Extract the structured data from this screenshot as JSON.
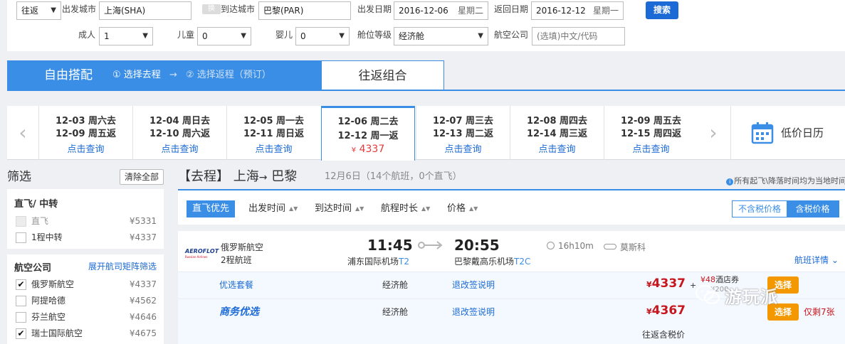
{
  "search": {
    "trip_type": "往返",
    "from_label": "出发城市",
    "from_value": "上海(SHA)",
    "swap_label": "换",
    "to_label": "到达城市",
    "to_value": "巴黎(PAR)",
    "depart_label": "出发日期",
    "depart_value": "2016-12-06",
    "depart_week": "星期二",
    "return_label": "返回日期",
    "return_value": "2016-12-12",
    "return_week": "星期一",
    "search_button": "搜索",
    "adult_label": "成人",
    "adult_value": "1",
    "child_label": "儿童",
    "child_value": "0",
    "infant_label": "婴儿",
    "infant_value": "0",
    "cabin_label": "舱位等级",
    "cabin_value": "经济舱",
    "airline_label": "航空公司",
    "airline_placeholder": "(选填)中文/代码"
  },
  "mode": {
    "free_title": "自由搭配",
    "step1": "① 选择去程",
    "step_arrow": "→",
    "step2": "② 选择返程（预订）",
    "round_title": "往返组合"
  },
  "dates": {
    "cells": [
      {
        "out": "12-03 周六去",
        "ret": "12-09 周五返",
        "action": "点击查询"
      },
      {
        "out": "12-04 周日去",
        "ret": "12-10 周六返",
        "action": "点击查询"
      },
      {
        "out": "12-05 周一去",
        "ret": "12-11 周日返",
        "action": "点击查询"
      },
      {
        "out": "12-06 周二去",
        "ret": "12-12 周一返",
        "currency": "¥",
        "price": "4337"
      },
      {
        "out": "12-07 周三去",
        "ret": "12-13 周二返",
        "action": "点击查询"
      },
      {
        "out": "12-08 周四去",
        "ret": "12-14 周三返",
        "action": "点击查询"
      },
      {
        "out": "12-09 周五去",
        "ret": "12-15 周四返",
        "action": "点击查询"
      }
    ],
    "calendar_label": "低价日历"
  },
  "filter": {
    "title": "筛选",
    "clear_button": "清除全部",
    "direct_title": "直飞/ 中转",
    "direct_items": [
      {
        "name": "直飞",
        "price": "¥5331"
      },
      {
        "name": "1程中转",
        "price": "¥4337"
      }
    ],
    "airline_title": "航空公司",
    "matrix_link": "展开航司矩阵筛选",
    "airlines": [
      {
        "name": "俄罗斯航空",
        "price": "¥4337",
        "check": "✔"
      },
      {
        "name": "阿提哈德",
        "price": "¥4562",
        "check": ""
      },
      {
        "name": "芬兰航空",
        "price": "¥4646",
        "check": ""
      },
      {
        "name": "瑞士国际航空",
        "price": "¥4675",
        "check": "✔"
      }
    ]
  },
  "route": {
    "title_prefix": "【去程】 上海",
    "title_arrow": "→",
    "title_suffix": " 巴黎",
    "meta": "12月6日（14个航班，0个直飞）",
    "note_icon": "i",
    "note": "所有起飞\\降落时间均为当地时间"
  },
  "sort": {
    "direct_first": "直飞优先",
    "depart_time": "出发时间",
    "arrive_time": "到达时间",
    "duration": "航程时长",
    "price": "价格",
    "updown": "▲▼",
    "excl_tax": "不含税价格",
    "incl_tax": "含税价格"
  },
  "flight": {
    "logo_text": "AEROFLOT",
    "logo_sub": "Russian Airlines",
    "airline": "俄罗斯航空",
    "legs": "2程航班",
    "dep_time": "11:45",
    "arr_time": "20:55",
    "dep_airport": "浦东国际机场",
    "dep_terminal": "T2",
    "arr_airport": "巴黎戴高乐机场",
    "arr_terminal": "T2C",
    "duration": "16h10m",
    "stop": "莫斯科",
    "detail_link": "航班详情 ⌄"
  },
  "fares": [
    {
      "label": "优选套餐",
      "cabin": "经济舱",
      "rule": "退改签说明",
      "currency": "¥",
      "price": "4337",
      "plus": "+",
      "coupon_currency": "¥",
      "coupon_amount": "48",
      "coupon_name": "酒店券",
      "coupon_sub": "¥200",
      "button": "选择"
    },
    {
      "label": "商务优选",
      "cabin": "经济舱",
      "rule": "退改签说明",
      "currency": "¥",
      "price": "4367",
      "button": "选择",
      "remaining": "仅剩7张",
      "tax_note": "往返含税价"
    }
  ],
  "watermark": "游玩派",
  "colors": {
    "accent": "#3a8ee6",
    "link": "#1b6ad6",
    "price": "#c8161d",
    "choose": "#f39800"
  }
}
